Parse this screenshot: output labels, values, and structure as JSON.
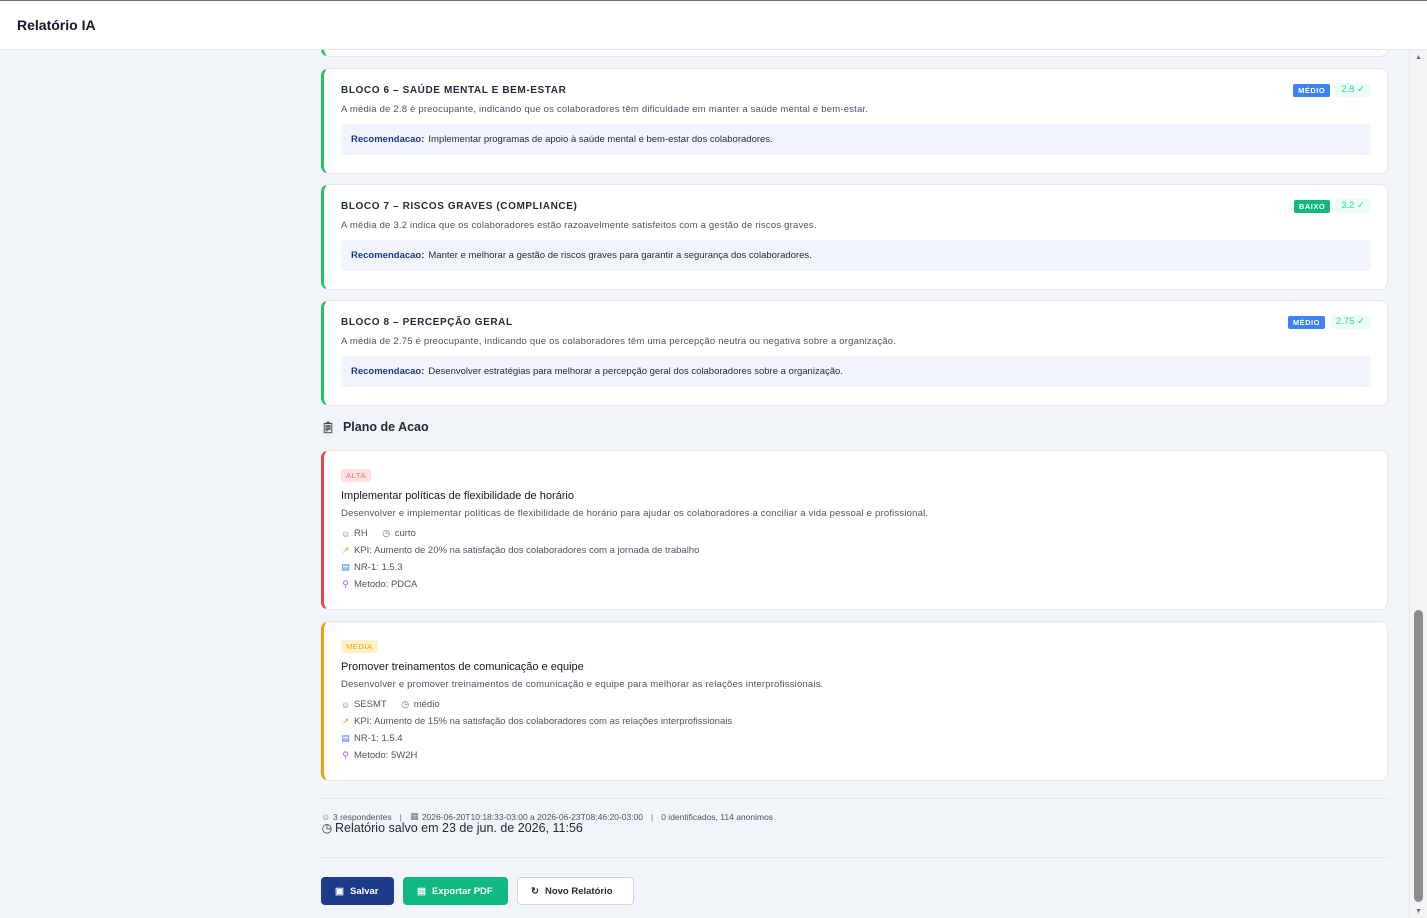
{
  "app": {
    "title": "Relatório IA"
  },
  "blocks": [
    {
      "title": "BLOCO 6 – SAÚDE MENTAL E BEM-ESTAR",
      "level": "MÉDIO",
      "score": "2.8 ✓",
      "description": "A média de 2.8 é preocupante, indicando que os colaboradores têm dificuldade em manter a saúde mental e bem-estar.",
      "reco_label": "Recomendacao:",
      "reco_text": "Implementar programas de apoio à saúde mental e bem-estar dos colaboradores."
    },
    {
      "title": "BLOCO 7 – RISCOS GRAVES (COMPLIANCE)",
      "level": "BAIXO",
      "score": "3.2 ✓",
      "description": "A média de 3.2 indica que os colaboradores estão razoavelmente satisfeitos com a gestão de riscos graves.",
      "reco_label": "Recomendacao:",
      "reco_text": "Manter e melhorar a gestão de riscos graves para garantir a segurança dos colaboradores."
    },
    {
      "title": "BLOCO 8 – PERCEPÇÃO GERAL",
      "level": "MÉDIO",
      "score": "2.75 ✓",
      "description": "A média de 2.75 é preocupante, indicando que os colaboradores têm uma percepção neutra ou negativa sobre a organização.",
      "reco_label": "Recomendacao:",
      "reco_text": "Desenvolver estratégias para melhorar a percepção geral dos colaboradores sobre a organização."
    }
  ],
  "action_plan": {
    "title": "Plano de Acao",
    "items": [
      {
        "priority": "ALTA",
        "title": "Implementar políticas de flexibilidade de horário",
        "description": "Desenvolver e implementar políticas de flexibilidade de horário para ajudar os colaboradores a conciliar a vida pessoal e profissional.",
        "owner": "RH",
        "term": "curto",
        "kpi": "KPI: Aumento de 20% na satisfação dos colaboradores com a jornada de trabalho",
        "nr": "NR-1: 1.5.3",
        "method": "Metodo: PDCA"
      },
      {
        "priority": "MEDIA",
        "title": "Promover treinamentos de comunicação e equipe",
        "description": "Desenvolver e promover treinamentos de comunicação e equipe para melhorar as relações interprofissionais.",
        "owner": "SESMT",
        "term": "médio",
        "kpi": "KPI: Aumento de 15% na satisfação dos colaboradores com as relações interprofissionais",
        "nr": "NR-1: 1.5.4",
        "method": "Metodo: 5W2H"
      }
    ]
  },
  "footer": {
    "respondents": "3 respondentes",
    "period": "2026-06-20T10:18:33-03:00 a 2026-06-23T08:46:20-03:00",
    "identification": "0 identificados, 114 anonimos",
    "saved": "Relatório salvo em 23 de jun. de 2026, 11:56"
  },
  "buttons": {
    "save": "Salvar",
    "export": "Exportar PDF",
    "new": "Novo Relatório"
  },
  "icons": {
    "clipboard": "clipboard-icon",
    "user": "user-icon",
    "clock": "clock-icon",
    "kpi": "chart-icon",
    "doc": "document-icon",
    "method": "magnifier-icon",
    "users": "users-icon",
    "calendar": "calendar-icon"
  }
}
